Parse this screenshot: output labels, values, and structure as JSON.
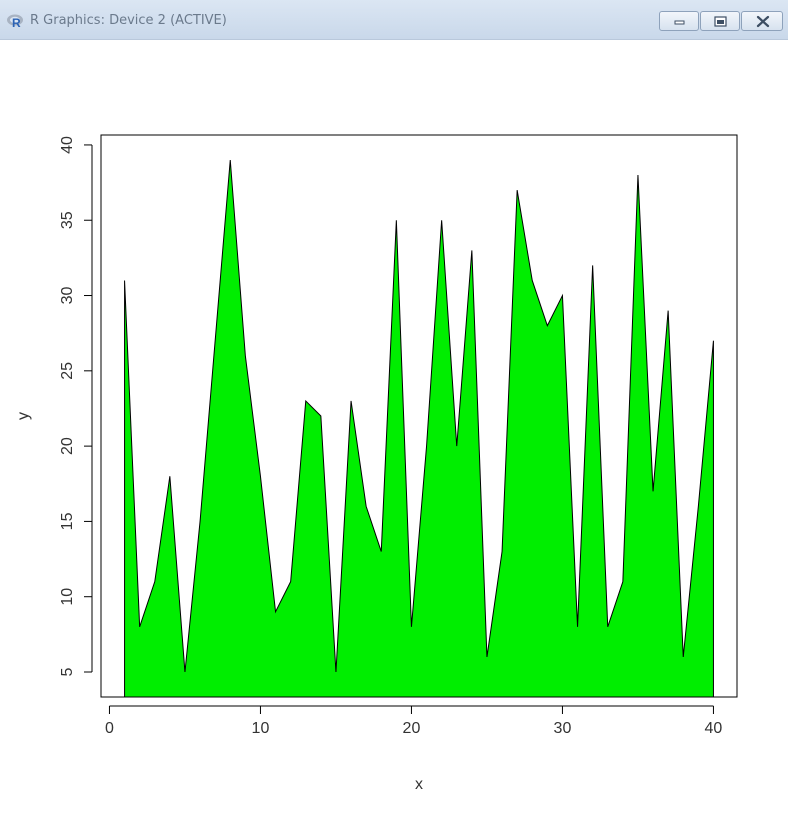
{
  "window": {
    "title": "R Graphics: Device 2 (ACTIVE)",
    "icons": {
      "app": "r-logo-icon",
      "minimize": "minimize-icon",
      "maximize": "maximize-icon",
      "close": "close-icon"
    }
  },
  "chart_data": {
    "type": "area",
    "title": "",
    "xlabel": "x",
    "ylabel": "y",
    "fill_color": "#00ee00",
    "line_color": "#000000",
    "xlim": [
      -0.56,
      41.56
    ],
    "ylim": [
      3.34,
      40.66
    ],
    "x_ticks": [
      0,
      10,
      20,
      30,
      40
    ],
    "y_ticks": [
      5,
      10,
      15,
      20,
      25,
      30,
      35,
      40
    ],
    "x": [
      1,
      2,
      3,
      4,
      5,
      6,
      7,
      8,
      9,
      10,
      11,
      12,
      13,
      14,
      15,
      16,
      17,
      18,
      19,
      20,
      21,
      22,
      23,
      24,
      25,
      26,
      27,
      28,
      29,
      30,
      31,
      32,
      33,
      34,
      35,
      36,
      37,
      38,
      39,
      40
    ],
    "y": [
      31,
      8,
      11,
      18,
      5,
      15,
      27,
      39,
      26,
      18,
      9,
      11,
      23,
      22,
      5,
      23,
      16,
      13,
      35,
      8,
      20,
      35,
      20,
      33,
      6,
      13,
      37,
      31,
      28,
      30,
      8,
      32,
      8,
      11,
      38,
      17,
      29,
      6,
      16,
      27
    ]
  }
}
